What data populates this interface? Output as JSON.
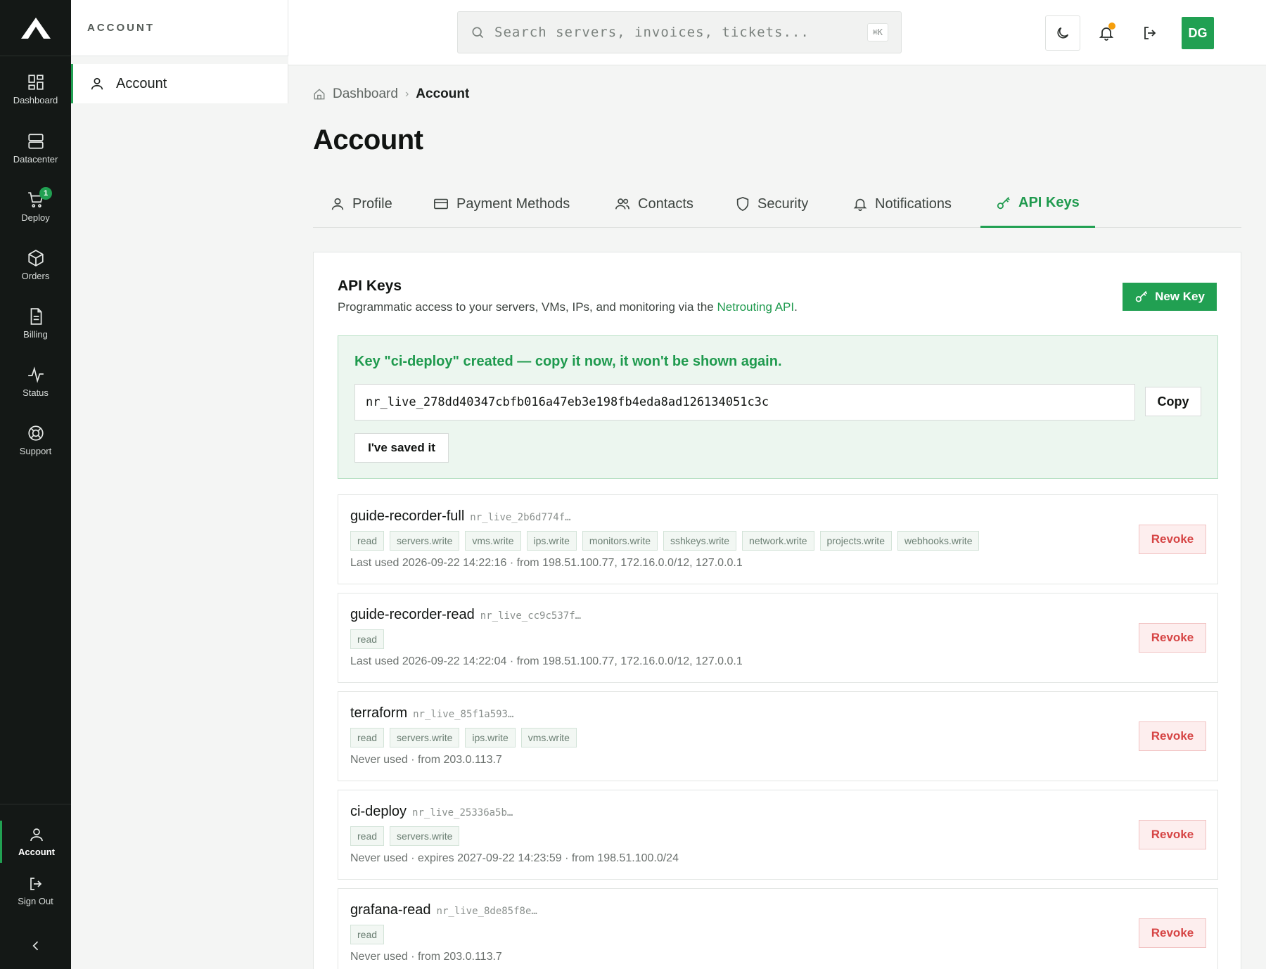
{
  "rail": {
    "items": [
      {
        "label": "Dashboard",
        "icon": "grid-icon"
      },
      {
        "label": "Datacenter",
        "icon": "server-icon"
      },
      {
        "label": "Deploy",
        "icon": "cart-icon",
        "badge": "1"
      },
      {
        "label": "Orders",
        "icon": "package-icon"
      },
      {
        "label": "Billing",
        "icon": "document-icon"
      },
      {
        "label": "Status",
        "icon": "pulse-icon"
      },
      {
        "label": "Support",
        "icon": "lifebuoy-icon"
      }
    ],
    "bottom": [
      {
        "label": "Account",
        "icon": "user-icon"
      },
      {
        "label": "Sign Out",
        "icon": "sign-out-icon"
      }
    ]
  },
  "subnav": {
    "heading": "ACCOUNT",
    "item": "Account"
  },
  "topbar": {
    "search_placeholder": "Search servers, invoices, tickets...",
    "shortcut": "⌘K",
    "avatar_initials": "DG"
  },
  "breadcrumb": {
    "home": "Dashboard",
    "separator": "›",
    "current": "Account"
  },
  "page_title": "Account",
  "tabs": [
    {
      "label": "Profile",
      "icon": "user-icon"
    },
    {
      "label": "Payment Methods",
      "icon": "credit-card-icon"
    },
    {
      "label": "Contacts",
      "icon": "users-icon"
    },
    {
      "label": "Security",
      "icon": "shield-icon"
    },
    {
      "label": "Notifications",
      "icon": "bell-icon"
    },
    {
      "label": "API Keys",
      "icon": "key-icon",
      "active": true
    }
  ],
  "card": {
    "title": "API Keys",
    "subtitle_before": "Programmatic access to your servers, VMs, IPs, and monitoring via the ",
    "subtitle_link": "Netrouting API",
    "subtitle_after": ".",
    "new_key_label": "New Key"
  },
  "created_notice": {
    "message": "Key \"ci-deploy\" created — copy it now, it won't be shown again.",
    "key_value": "nr_live_278dd40347cbfb016a47eb3e198fb4eda8ad126134051c3c",
    "copy_label": "Copy",
    "saved_label": "I've saved it"
  },
  "keys": [
    {
      "name": "guide-recorder-full",
      "prefix": "nr_live_2b6d774f…",
      "scopes": [
        "read",
        "servers.write",
        "vms.write",
        "ips.write",
        "monitors.write",
        "sshkeys.write",
        "network.write",
        "projects.write",
        "webhooks.write"
      ],
      "meta": "Last used 2026-09-22 14:22:16 · from 198.51.100.77, 172.16.0.0/12, 127.0.0.1",
      "revoke_label": "Revoke"
    },
    {
      "name": "guide-recorder-read",
      "prefix": "nr_live_cc9c537f…",
      "scopes": [
        "read"
      ],
      "meta": "Last used 2026-09-22 14:22:04 · from 198.51.100.77, 172.16.0.0/12, 127.0.0.1",
      "revoke_label": "Revoke"
    },
    {
      "name": "terraform",
      "prefix": "nr_live_85f1a593…",
      "scopes": [
        "read",
        "servers.write",
        "ips.write",
        "vms.write"
      ],
      "meta": "Never used · from 203.0.113.7",
      "revoke_label": "Revoke"
    },
    {
      "name": "ci-deploy",
      "prefix": "nr_live_25336a5b…",
      "scopes": [
        "read",
        "servers.write"
      ],
      "meta": "Never used · expires 2027-09-22 14:23:59 · from 198.51.100.0/24",
      "revoke_label": "Revoke"
    },
    {
      "name": "grafana-read",
      "prefix": "nr_live_8de85f8e…",
      "scopes": [
        "read"
      ],
      "meta": "Never used · from 203.0.113.7",
      "revoke_label": "Revoke"
    }
  ],
  "colors": {
    "accent": "#21a052",
    "rail_bg": "#141816",
    "danger": "#d64545",
    "notification_dot": "#f59e0b"
  }
}
